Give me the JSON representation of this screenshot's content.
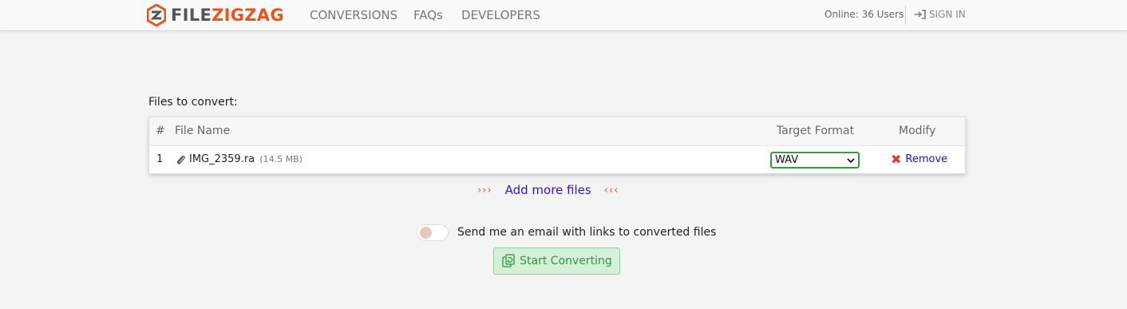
{
  "nav": {
    "logo_file": "FILE",
    "logo_zigzag": "ZIGZAG",
    "links": [
      "CONVERSIONS",
      "FAQs",
      "DEVELOPERS"
    ],
    "online": "Online: 36 Users",
    "signin": "SIGN IN",
    "logo_color": "#e8561e"
  },
  "files_label": "Files to convert:",
  "table": {
    "headers": [
      "#",
      "File Name",
      "Target Format",
      "Modify"
    ],
    "rows": [
      {
        "num": "1",
        "name": "IMG_2359.ra",
        "size": "(14.5 MB)",
        "format": "WAV",
        "action": "Remove"
      }
    ]
  },
  "add_more": {
    "left_arrows": "›››",
    "label": "Add more files",
    "right_arrows": "‹‹‹"
  },
  "email_toggle": {
    "label": "Send me an email with links to converted files",
    "on": false
  },
  "start_button": {
    "label": "Start Converting",
    "color": "#2a9a3a"
  },
  "icons": [
    "logo-icon",
    "signin-icon",
    "paperclip-icon",
    "chevron-down-icon",
    "close-icon",
    "convert-icon"
  ]
}
